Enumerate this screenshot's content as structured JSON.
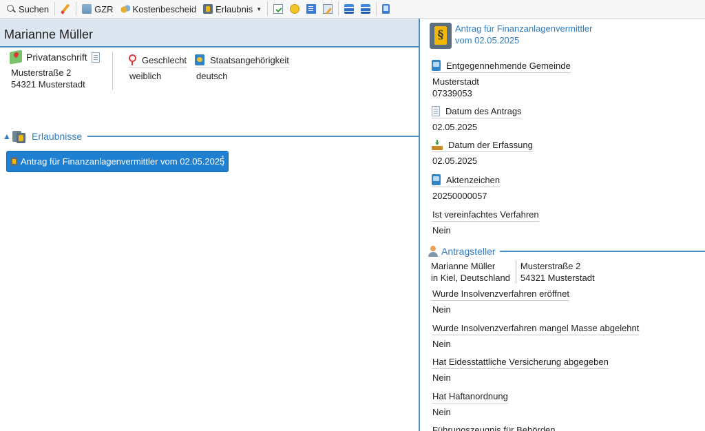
{
  "toolbar": {
    "search_label": "Suchen",
    "gzr_label": "GZR",
    "cost_label": "Kostenbescheid",
    "permit_label": "Erlaubnis"
  },
  "person": {
    "name": "Marianne Müller",
    "address_heading": "Privatanschrift",
    "street": "Musterstraße 2",
    "city": "54321 Musterstadt",
    "gender_label": "Geschlecht",
    "gender_value": "weiblich",
    "nationality_label": "Staatsangehörigkeit",
    "nationality_value": "deutsch"
  },
  "permits": {
    "section_title": "Erlaubnisse",
    "items": [
      {
        "label": "Antrag für Finanzanlagenvermittler vom 02.05.2025"
      }
    ]
  },
  "detail": {
    "title_line1": "Antrag für Finanzanlagenvermittler",
    "title_line2": "vom 02.05.2025",
    "fields": [
      {
        "label": "Entgegennehmende Gemeinde",
        "value_line1": "Musterstadt",
        "value_line2": "07339053"
      },
      {
        "label": "Datum des Antrags",
        "value": "02.05.2025"
      },
      {
        "label": "Datum der Erfassung",
        "value": "02.05.2025"
      },
      {
        "label": "Aktenzeichen",
        "value": "20250000057"
      },
      {
        "label": "Ist vereinfachtes Verfahren",
        "value": "Nein"
      }
    ],
    "applicant": {
      "section_title": "Antragsteller",
      "name": "Marianne Müller",
      "birthplace": "in Kiel, Deutschland",
      "street": "Musterstraße 2",
      "city": "54321 Musterstadt"
    },
    "questions": [
      {
        "label": "Wurde Insolvenzverfahren eröffnet",
        "value": "Nein"
      },
      {
        "label": "Wurde Insolvenzverfahren mangel Masse abgelehnt",
        "value": "Nein"
      },
      {
        "label": "Hat Eidesstattliche Versicherung abgegeben",
        "value": "Nein"
      },
      {
        "label": "Hat Haftanordnung",
        "value": "Nein"
      },
      {
        "label": "Führungszeugnis für Behörden"
      }
    ]
  }
}
